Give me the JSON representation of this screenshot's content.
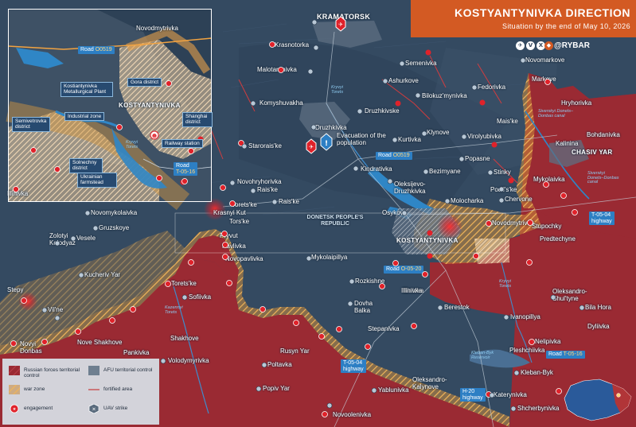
{
  "title": {
    "main": "KOSTYANTYNIVKA DIRECTION",
    "sub": "Situation by the end of May 10, 2026"
  },
  "brand": {
    "name": "@RYBAR"
  },
  "colors": {
    "russian_control": "#9a2a33",
    "afu_control": "#3a4e66",
    "war_zone": "#d99a3e",
    "water": "#2f86c6",
    "road_tag": "#2d7fc4",
    "title_bg": "#d35a23",
    "strike": "#e0222a"
  },
  "legend": {
    "items": [
      {
        "key": "russian",
        "icon": "hatched-red-square-icon",
        "text": "Russian forces territorial control"
      },
      {
        "key": "afu",
        "icon": "gray-square-icon",
        "text": "AFU territorial control"
      },
      {
        "key": "warzone",
        "icon": "orange-hatched-square-icon",
        "text": "war zone"
      },
      {
        "key": "fortified",
        "icon": "red-line-icon",
        "text": "fortified area"
      },
      {
        "key": "engagement",
        "icon": "engagement-icon",
        "text": "engagement"
      },
      {
        "key": "uav",
        "icon": "uav-strike-icon",
        "text": "UAV strike"
      }
    ]
  },
  "main_map": {
    "places": [
      {
        "name": "KRAMATORSK",
        "type": "city"
      },
      {
        "name": "Krasnotorka"
      },
      {
        "name": "Malotaranivka"
      },
      {
        "name": "Komyshuvakha"
      },
      {
        "name": "Druzhkivka"
      },
      {
        "name": "Druzhkivske"
      },
      {
        "name": "Starorais'ke"
      },
      {
        "name": "Novohryhorivka"
      },
      {
        "name": "Rais'ke"
      },
      {
        "name": "Rais'ke"
      },
      {
        "name": "Kindrativka"
      },
      {
        "name": "Oleksijevo-Druzhkivka"
      },
      {
        "name": "Osykove"
      },
      {
        "name": "Mykolaipillya"
      },
      {
        "name": "KOSTYANTYNIVKA",
        "type": "city"
      },
      {
        "name": "Semenivka"
      },
      {
        "name": "Ashurkove"
      },
      {
        "name": "Bilokuz'mynivka"
      },
      {
        "name": "Novomarkove"
      },
      {
        "name": "Fedorivka"
      },
      {
        "name": "Markove"
      },
      {
        "name": "Hryhorivka"
      },
      {
        "name": "Mais'ke"
      },
      {
        "name": "Bohdanivka"
      },
      {
        "name": "Kalinina"
      },
      {
        "name": "CHASIV YAR",
        "type": "city"
      },
      {
        "name": "Kurtivka"
      },
      {
        "name": "Klynove"
      },
      {
        "name": "Virolyubivka"
      },
      {
        "name": "Popasne"
      },
      {
        "name": "Bezimyane"
      },
      {
        "name": "Stinky"
      },
      {
        "name": "Mykolaivka"
      },
      {
        "name": "Podil's'ke"
      },
      {
        "name": "Chervone"
      },
      {
        "name": "Molocharka"
      },
      {
        "name": "Novodmytrivka"
      },
      {
        "name": "Stupochky"
      },
      {
        "name": "Predtechyne"
      },
      {
        "name": "Illinivka"
      },
      {
        "name": "Novomykolaivka"
      },
      {
        "name": "Gruzskoye"
      },
      {
        "name": "Torets'ke"
      },
      {
        "name": "Krasnyi Kut"
      },
      {
        "name": "Tors'ke"
      },
      {
        "name": "Veselе"
      },
      {
        "name": "Pryvut"
      },
      {
        "name": "Pavlivka"
      },
      {
        "name": "Zolotyi Kolodyaz"
      },
      {
        "name": "Novopavlivka"
      },
      {
        "name": "Kucheriv Yar"
      },
      {
        "name": "Stepy"
      },
      {
        "name": "Vil'ne"
      },
      {
        "name": "Torets'ke"
      },
      {
        "name": "Sofiivka"
      },
      {
        "name": "Rozkishne"
      },
      {
        "name": "Illinivka"
      },
      {
        "name": "Dovha Balka"
      },
      {
        "name": "Berestok"
      },
      {
        "name": "Oleksandro-Shul'tyne"
      },
      {
        "name": "Bila Hora"
      },
      {
        "name": "Dyliivka"
      },
      {
        "name": "Ivanopillya"
      },
      {
        "name": "Stepanivka"
      },
      {
        "name": "Novyi Donbas"
      },
      {
        "name": "Nove Shakhove"
      },
      {
        "name": "Shakhove"
      },
      {
        "name": "Pankivka"
      },
      {
        "name": "Volodymyrivka"
      },
      {
        "name": "Rusyn Yar"
      },
      {
        "name": "Poltavka"
      },
      {
        "name": "Popiv Yar"
      },
      {
        "name": "Oleksandro-Kalynove"
      },
      {
        "name": "Yablunivka"
      },
      {
        "name": "Nelipivka"
      },
      {
        "name": "Pleshchiivka"
      },
      {
        "name": "Kleban-Byk"
      },
      {
        "name": "Katerynivka"
      },
      {
        "name": "Shcherbynivka"
      },
      {
        "name": "Novoolenivka"
      },
      {
        "name": "Illinivka"
      }
    ],
    "region_label": "DONETSK PEOPLE'S REPUBLIC",
    "rivers": [
      "Kryvyi Torets",
      "Kryvyi Torets",
      "Kazennyi Torets",
      "Siverskyi Donets–Donbas canal",
      "Siverskyi Donets–Donbas canal",
      "Kleban-Byk Reservoir"
    ],
    "evacuation_note": "Evacuation of the population",
    "roads": [
      {
        "prefix": "Road",
        "code": "O0519"
      },
      {
        "prefix": "Road",
        "code": "O-05-20"
      },
      {
        "prefix": "",
        "code": "T-05-04",
        "suffix": "highway"
      },
      {
        "prefix": "",
        "code": "T-05-04",
        "suffix": "highway"
      },
      {
        "prefix": "Road",
        "code": "T-05-16"
      },
      {
        "prefix": "",
        "code": "H-20",
        "suffix": "highway"
      }
    ]
  },
  "inset": {
    "places": [
      {
        "name": "Novodmytrivka"
      },
      {
        "name": "KOSTYANTYNIVKA",
        "type": "city"
      },
      {
        "name": "Illinivka"
      }
    ],
    "districts": [
      {
        "label": "Gora district"
      },
      {
        "label": "Kostiantynivka Metallurgical Plant"
      },
      {
        "label": "Semivetrovka district"
      },
      {
        "label": "Industrial zone"
      },
      {
        "label": "Shanghai district"
      },
      {
        "label": "Railway station"
      },
      {
        "label": "Solnechny district"
      },
      {
        "label": "Ukrainian farmstead"
      }
    ],
    "roads": [
      {
        "prefix": "Road",
        "code": "O0519"
      },
      {
        "prefix": "Road",
        "code": "T-05-16"
      }
    ],
    "river": "Kryvyi Torets"
  }
}
